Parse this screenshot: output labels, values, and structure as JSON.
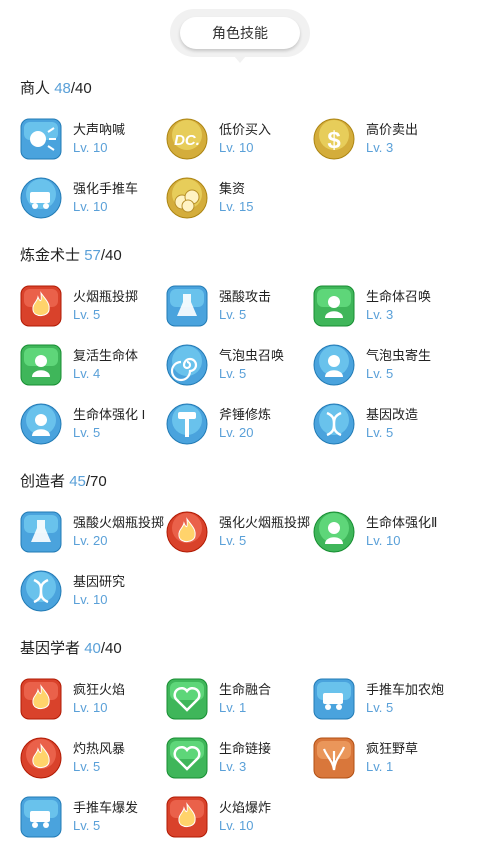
{
  "header": {
    "title": "角色技能"
  },
  "sections": [
    {
      "name": "商人",
      "current": "48",
      "max": "/40"
    },
    {
      "name": "炼金术士",
      "current": "57",
      "max": "/40"
    },
    {
      "name": "创造者",
      "current": "45",
      "max": "/70"
    },
    {
      "name": "基因学者",
      "current": "40",
      "max": "/40"
    }
  ],
  "skills": [
    {
      "name": "大声吶喊",
      "level": "Lv. 10",
      "icon": "shout-icon",
      "color": "#4aa3dd"
    },
    {
      "name": "低价买入",
      "level": "Lv. 10",
      "icon": "dc-coin-icon",
      "color": "#d4ad3b"
    },
    {
      "name": "高价卖出",
      "level": "Lv. 3",
      "icon": "dollar-coin-icon",
      "color": "#d4ad3b"
    },
    {
      "name": "强化手推车",
      "level": "Lv. 10",
      "icon": "cart-upgrade-icon",
      "color": "#4aa3dd"
    },
    {
      "name": "集资",
      "level": "Lv. 15",
      "icon": "coin-pile-icon",
      "color": "#d4ad3b"
    },
    {
      "name": "火烟瓶投掷",
      "level": "Lv. 5",
      "icon": "fire-bottle-icon",
      "color": "#d9422b"
    },
    {
      "name": "强酸攻击",
      "level": "Lv. 5",
      "icon": "acid-flask-icon",
      "color": "#4aa3dd"
    },
    {
      "name": "生命体召唤",
      "level": "Lv. 3",
      "icon": "summon-homunculus-icon",
      "color": "#3fb65a"
    },
    {
      "name": "复活生命体",
      "level": "Lv. 4",
      "icon": "resurrect-homunculus-icon",
      "color": "#3fb65a"
    },
    {
      "name": "气泡虫召唤",
      "level": "Lv. 5",
      "icon": "swirl-icon",
      "color": "#4aa3dd"
    },
    {
      "name": "气泡虫寄生",
      "level": "Lv. 5",
      "icon": "bubble-parasite-icon",
      "color": "#4aa3dd"
    },
    {
      "name": "生命体强化 I",
      "level": "Lv. 5",
      "icon": "homunculus-boost-icon",
      "color": "#4aa3dd"
    },
    {
      "name": "斧锤修炼",
      "level": "Lv. 20",
      "icon": "axe-hammer-icon",
      "color": "#4aa3dd"
    },
    {
      "name": "基因改造",
      "level": "Lv. 5",
      "icon": "dna-icon",
      "color": "#4aa3dd"
    },
    {
      "name": "强酸火烟瓶投掷",
      "level": "Lv. 20",
      "icon": "acid-bomb-icon",
      "color": "#4aa3dd"
    },
    {
      "name": "强化火烟瓶投掷",
      "level": "Lv. 5",
      "icon": "fire-bomb-icon",
      "color": "#d9422b"
    },
    {
      "name": "生命体强化Ⅱ",
      "level": "Lv. 10",
      "icon": "homunculus-boost-2-icon",
      "color": "#3fb65a"
    },
    {
      "name": "基因研究",
      "level": "Lv. 10",
      "icon": "gene-research-icon",
      "color": "#4aa3dd"
    },
    {
      "name": "疯狂火焰",
      "level": "Lv. 10",
      "icon": "crazy-flame-icon",
      "color": "#d9422b"
    },
    {
      "name": "生命融合",
      "level": "Lv. 1",
      "icon": "life-fusion-icon",
      "color": "#3fb65a"
    },
    {
      "name": "手推车加农炮",
      "level": "Lv. 5",
      "icon": "cart-cannon-icon",
      "color": "#4aa3dd"
    },
    {
      "name": "灼热风暴",
      "level": "Lv. 5",
      "icon": "fire-storm-icon",
      "color": "#d9422b"
    },
    {
      "name": "生命链接",
      "level": "Lv. 3",
      "icon": "life-link-icon",
      "color": "#3fb65a"
    },
    {
      "name": "疯狂野草",
      "level": "Lv. 1",
      "icon": "crazy-weed-icon",
      "color": "#d9773b"
    },
    {
      "name": "手推车爆发",
      "level": "Lv. 5",
      "icon": "cart-boost-icon",
      "color": "#4aa3dd"
    },
    {
      "name": "火焰爆炸",
      "level": "Lv. 10",
      "icon": "fire-explosion-icon",
      "color": "#d9422b"
    }
  ]
}
